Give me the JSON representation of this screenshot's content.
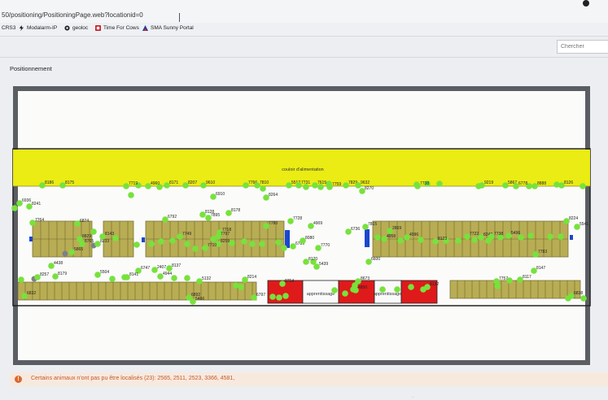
{
  "browser": {
    "url": "50/positioning/PositioningPage.web?locationid=0",
    "bookmarks": [
      {
        "label": "CRS3",
        "icon": "none"
      },
      {
        "label": "Modalarm-IP",
        "icon": "lightning-icon"
      },
      {
        "label": "geoloc",
        "icon": "geoloc-icon"
      },
      {
        "label": "Time For Cows",
        "icon": "time-for-cows-icon"
      },
      {
        "label": "SMA Sunny Portal",
        "icon": "sunny-portal-icon"
      }
    ]
  },
  "header": {
    "search_placeholder": "Chercher",
    "page_title": "Positionnement"
  },
  "map": {
    "feeding_alley_label": "couloir d'alimentation",
    "apprentissage_labels": [
      "apprentissage",
      "apprentissage"
    ],
    "colors": {
      "feeding_alley": "#eaec13",
      "stalls": "#b8ad54",
      "stall_lines": "#6d6628",
      "animal_dot": "#77e23c",
      "inactive_dot": "#7c8186",
      "red_zone": "#df1a1a",
      "blue_marker": "#1b47d0",
      "frame": "#5a5e63"
    },
    "animals": [
      {
        "id": "8186"
      },
      {
        "id": "8175"
      },
      {
        "id": "7719"
      },
      {
        "id": "4960"
      },
      {
        "id": "8171"
      },
      {
        "id": "8207"
      },
      {
        "id": "9610"
      },
      {
        "id": "7766"
      },
      {
        "id": "7810"
      },
      {
        "id": "5512"
      },
      {
        "id": "7731"
      },
      {
        "id": "7615"
      },
      {
        "id": "7759"
      },
      {
        "id": "7829"
      },
      {
        "id": "9632"
      },
      {
        "id": "8270"
      },
      {
        "id": "7738"
      },
      {
        "id": "9219"
      },
      {
        "id": "5867"
      },
      {
        "id": "6778"
      },
      {
        "id": "8888"
      },
      {
        "id": "8126"
      },
      {
        "id": "6910"
      },
      {
        "id": "8264"
      },
      {
        "id": "6936"
      },
      {
        "id": "8241"
      },
      {
        "id": "7764"
      },
      {
        "id": "6874"
      },
      {
        "id": "6792"
      },
      {
        "id": "8128"
      },
      {
        "id": "7895"
      },
      {
        "id": "8178"
      },
      {
        "id": "7728"
      },
      {
        "id": "7780"
      },
      {
        "id": "4909"
      },
      {
        "id": "8829"
      },
      {
        "id": "8765"
      },
      {
        "id": "8233"
      },
      {
        "id": "8143"
      },
      {
        "id": "5865"
      },
      {
        "id": "8259"
      },
      {
        "id": "7749"
      },
      {
        "id": "7710"
      },
      {
        "id": "7718"
      },
      {
        "id": "7797"
      },
      {
        "id": "6789"
      },
      {
        "id": "8080"
      },
      {
        "id": "7770"
      },
      {
        "id": "6736"
      },
      {
        "id": "7815"
      },
      {
        "id": "2869"
      },
      {
        "id": "4958"
      },
      {
        "id": "4996"
      },
      {
        "id": "8123"
      },
      {
        "id": "7722"
      },
      {
        "id": "8243"
      },
      {
        "id": "7738"
      },
      {
        "id": "5496"
      },
      {
        "id": "8224"
      },
      {
        "id": "5541"
      },
      {
        "id": "6600"
      },
      {
        "id": "7783"
      },
      {
        "id": "8147"
      },
      {
        "id": "4438"
      },
      {
        "id": "8257"
      },
      {
        "id": "8179"
      },
      {
        "id": "5504"
      },
      {
        "id": "6747"
      },
      {
        "id": "2407"
      },
      {
        "id": "8137"
      },
      {
        "id": "4944"
      },
      {
        "id": "8141"
      },
      {
        "id": "8214"
      },
      {
        "id": "8170"
      },
      {
        "id": "5439"
      },
      {
        "id": "8673"
      },
      {
        "id": "8117"
      },
      {
        "id": "7757"
      },
      {
        "id": "6832"
      },
      {
        "id": "6892"
      },
      {
        "id": "5466"
      },
      {
        "id": "5132"
      },
      {
        "id": "6797"
      },
      {
        "id": "8754"
      },
      {
        "id": "4850"
      },
      {
        "id": "8132"
      },
      {
        "id": "6838"
      }
    ]
  },
  "alert": {
    "text": "Certains animaux n'ont pas pu être localisés (23): 2565, 2511, 2523, 3366, 4581,"
  },
  "footer": {
    "text": "..."
  }
}
